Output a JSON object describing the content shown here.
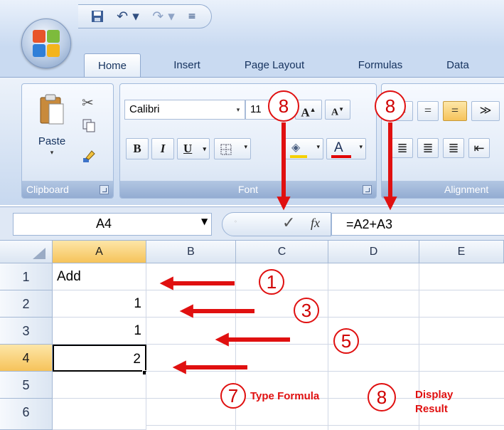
{
  "tabs": [
    "Home",
    "Insert",
    "Page Layout",
    "Formulas",
    "Data"
  ],
  "clipboard": {
    "paste_label": "Paste",
    "group_label": "Clipboard"
  },
  "font_group": {
    "font_name": "Calibri",
    "font_size": "11",
    "bold": "B",
    "italic": "I",
    "underline": "U",
    "grow": "A",
    "shrink": "A",
    "font_color": "A",
    "group_label": "Font"
  },
  "alignment": {
    "group_label": "Alignment"
  },
  "formula_bar": {
    "name_box": "A4",
    "fx": "fx",
    "formula": "=A2+A3"
  },
  "columns": [
    "A",
    "B",
    "C",
    "D",
    "E"
  ],
  "rows": [
    "1",
    "2",
    "3",
    "4",
    "5",
    "6"
  ],
  "cells": {
    "A1": "Add",
    "A2": "1",
    "A3": "1",
    "A4": "2"
  },
  "callouts": {
    "c8a": "8",
    "c8b": "8",
    "c1": "1",
    "c3": "3",
    "c5": "5",
    "c7": "7",
    "c8c": "8"
  },
  "notes": {
    "type_formula": "Type Formula",
    "display": "Display",
    "result": "Result"
  },
  "colors": {
    "accent_red": "#e01010",
    "selected_header": "#f6c35a",
    "ribbon_blue": "#c9daf1"
  }
}
